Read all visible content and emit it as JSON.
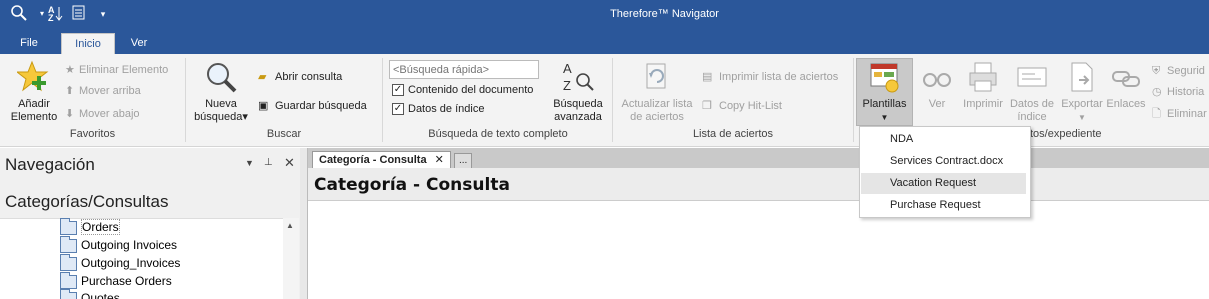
{
  "app": {
    "title": "Therefore™ Navigator"
  },
  "quick_access": {
    "search_icon": "search-icon",
    "sort_icon": "sort-az-icon",
    "screen_icon": "screen-icon",
    "customize_icon": "customize-icon"
  },
  "ribbon_tabs": [
    {
      "label": "File"
    },
    {
      "label": "Inicio"
    },
    {
      "label": "Ver"
    }
  ],
  "favoritos": {
    "label": "Favoritos",
    "add": "Añadir\nElemento",
    "add_line1": "Añadir",
    "add_line2": "Elemento",
    "remove": "Eliminar Elemento",
    "up": "Mover arriba",
    "down": "Mover abajo"
  },
  "buscar": {
    "label": "Buscar",
    "new_line1": "Nueva",
    "new_line2": "búsqueda",
    "open": "Abrir consulta",
    "save": "Guardar búsqueda"
  },
  "fulltext": {
    "label": "Búsqueda de texto completo",
    "placeholder": "<Búsqueda rápida>",
    "opt1": "Contenido del documento",
    "opt2": "Datos de índice",
    "adv_line1": "Búsqueda",
    "adv_line2": "avanzada"
  },
  "hitlist": {
    "label": "Lista de aciertos",
    "refresh_line1": "Actualizar lista",
    "refresh_line2": "de aciertos",
    "print": "Imprimir lista de aciertos",
    "copy": "Copy Hit-List"
  },
  "docs": {
    "label_partial": "tos/expediente",
    "templates": "Plantillas",
    "view": "Ver",
    "print": "Imprimir",
    "index_line1": "Datos de",
    "index_line2": "índice",
    "export": "Exportar",
    "links": "Enlaces",
    "security": "Segurid",
    "history": "Historia",
    "delete": "Eliminar"
  },
  "templates_menu": [
    {
      "label": "NDA"
    },
    {
      "label": "Services Contract.docx"
    },
    {
      "label": "Vacation Request"
    },
    {
      "label": "Purchase Request"
    }
  ],
  "nav": {
    "title": "Navegación",
    "section": "Categorías/Consultas",
    "items": [
      {
        "label": "Orders"
      },
      {
        "label": "Outgoing Invoices"
      },
      {
        "label": "Outgoing_Invoices"
      },
      {
        "label": "Purchase Orders"
      },
      {
        "label": "Quotes"
      }
    ]
  },
  "document": {
    "tab": "Categoría - Consulta",
    "more_tab": "...",
    "header": "Categoría - Consulta"
  }
}
